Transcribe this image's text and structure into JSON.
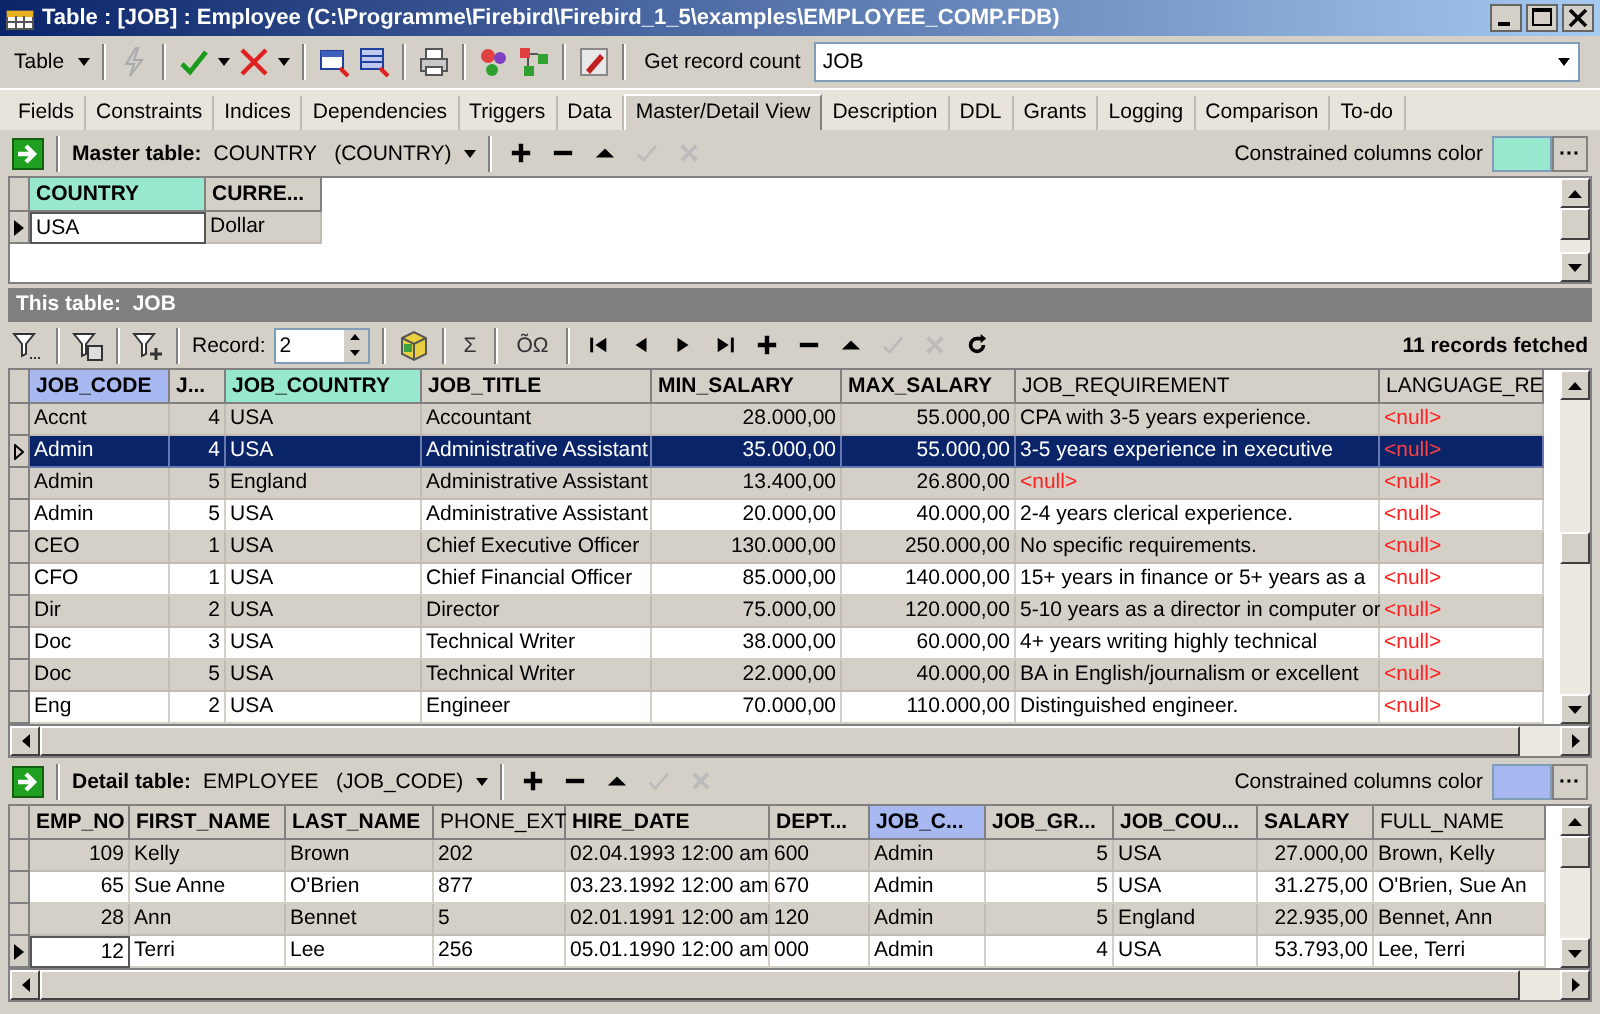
{
  "window": {
    "title": "Table : [JOB] : Employee (C:\\Programme\\Firebird\\Firebird_1_5\\examples\\EMPLOYEE_COMP.FDB)"
  },
  "toolbar": {
    "table_menu": "Table",
    "get_record_count": "Get record count",
    "table_combo": "JOB"
  },
  "tabs": [
    {
      "label": "Fields",
      "selected": false
    },
    {
      "label": "Constraints",
      "selected": false
    },
    {
      "label": "Indices",
      "selected": false
    },
    {
      "label": "Dependencies",
      "selected": false
    },
    {
      "label": "Triggers",
      "selected": false
    },
    {
      "label": "Data",
      "selected": false
    },
    {
      "label": "Master/Detail View",
      "selected": true
    },
    {
      "label": "Description",
      "selected": false
    },
    {
      "label": "DDL",
      "selected": false
    },
    {
      "label": "Grants",
      "selected": false
    },
    {
      "label": "Logging",
      "selected": false
    },
    {
      "label": "Comparison",
      "selected": false
    },
    {
      "label": "To-do",
      "selected": false
    }
  ],
  "master": {
    "label": "Master table:",
    "table": "COUNTRY   (COUNTRY)",
    "color_label": "Constrained columns color",
    "color": "#98e8d0",
    "picker": "···",
    "grid": {
      "columns": [
        {
          "name": "COUNTRY",
          "bold": true,
          "color": "#98e8d0"
        },
        {
          "name": "CURRE...",
          "bold": true
        }
      ],
      "rows": [
        {
          "cells": [
            "USA",
            "Dollar"
          ],
          "current": true
        }
      ]
    }
  },
  "this_table": "This table:  JOB",
  "job_toolbar": {
    "record_label": "Record:",
    "record": "2",
    "sigma": "Σ",
    "omega": "ÕΩ",
    "status": "11 records fetched"
  },
  "job_grid": {
    "columns": [
      {
        "name": "JOB_CODE",
        "bold": true,
        "numeric": false,
        "color": "#a8b8f0"
      },
      {
        "name": "J...",
        "bold": true,
        "numeric": true
      },
      {
        "name": "JOB_COUNTRY",
        "bold": true,
        "numeric": false,
        "color": "#98e8d0"
      },
      {
        "name": "JOB_TITLE",
        "bold": true,
        "numeric": false
      },
      {
        "name": "MIN_SALARY",
        "bold": true,
        "numeric": true
      },
      {
        "name": "MAX_SALARY",
        "bold": true,
        "numeric": true
      },
      {
        "name": "JOB_REQUIREMENT",
        "bold": false,
        "numeric": false
      },
      {
        "name": "LANGUAGE_RE",
        "bold": false,
        "numeric": false
      }
    ],
    "rows": [
      {
        "cells": [
          "Accnt",
          "4",
          "USA",
          "Accountant",
          "28.000,00",
          "55.000,00",
          "CPA with 3-5 years experience.",
          {
            "text": "<null>",
            "null": true
          }
        ],
        "selected": false
      },
      {
        "cells": [
          "Admin",
          "4",
          "USA",
          "Administrative Assistant",
          "35.000,00",
          "55.000,00",
          "3-5 years experience in executive",
          {
            "text": "<null>",
            "null": true
          }
        ],
        "selected": true
      },
      {
        "cells": [
          "Admin",
          "5",
          "England",
          "Administrative Assistant",
          "13.400,00",
          "26.800,00",
          {
            "text": "<null>",
            "null": true
          },
          {
            "text": "<null>",
            "null": true
          }
        ],
        "selected": false
      },
      {
        "cells": [
          "Admin",
          "5",
          "USA",
          "Administrative Assistant",
          "20.000,00",
          "40.000,00",
          "2-4 years clerical experience.",
          {
            "text": "<null>",
            "null": true
          }
        ],
        "selected": false
      },
      {
        "cells": [
          "CEO",
          "1",
          "USA",
          "Chief Executive Officer",
          "130.000,00",
          "250.000,00",
          "No specific requirements.",
          {
            "text": "<null>",
            "null": true
          }
        ],
        "selected": false
      },
      {
        "cells": [
          "CFO",
          "1",
          "USA",
          "Chief Financial Officer",
          "85.000,00",
          "140.000,00",
          "15+ years in finance or 5+ years as a",
          {
            "text": "<null>",
            "null": true
          }
        ],
        "selected": false
      },
      {
        "cells": [
          "Dir",
          "2",
          "USA",
          "Director",
          "75.000,00",
          "120.000,00",
          "5-10 years as a director in computer or",
          {
            "text": "<null>",
            "null": true
          }
        ],
        "selected": false
      },
      {
        "cells": [
          "Doc",
          "3",
          "USA",
          "Technical Writer",
          "38.000,00",
          "60.000,00",
          "4+ years writing highly technical",
          {
            "text": "<null>",
            "null": true
          }
        ],
        "selected": false
      },
      {
        "cells": [
          "Doc",
          "5",
          "USA",
          "Technical Writer",
          "22.000,00",
          "40.000,00",
          "BA in English/journalism or excellent",
          {
            "text": "<null>",
            "null": true
          }
        ],
        "selected": false
      },
      {
        "cells": [
          "Eng",
          "2",
          "USA",
          "Engineer",
          "70.000,00",
          "110.000,00",
          "Distinguished engineer.",
          {
            "text": "<null>",
            "null": true
          }
        ],
        "selected": false
      }
    ]
  },
  "detail": {
    "label": "Detail table:",
    "table": "EMPLOYEE   (JOB_CODE)",
    "color_label": "Constrained columns color",
    "color": "#a8b8f0",
    "picker": "···",
    "grid": {
      "columns": [
        {
          "name": "EMP_NO",
          "bold": true,
          "numeric": true
        },
        {
          "name": "FIRST_NAME",
          "bold": true,
          "numeric": false
        },
        {
          "name": "LAST_NAME",
          "bold": true,
          "numeric": false
        },
        {
          "name": "PHONE_EXT",
          "bold": false,
          "numeric": false
        },
        {
          "name": "HIRE_DATE",
          "bold": true,
          "numeric": false
        },
        {
          "name": "DEPT...",
          "bold": true,
          "numeric": false
        },
        {
          "name": "JOB_C...",
          "bold": true,
          "numeric": false,
          "color": "#a8b8f0"
        },
        {
          "name": "JOB_GR...",
          "bold": true,
          "numeric": true
        },
        {
          "name": "JOB_COU...",
          "bold": true,
          "numeric": false
        },
        {
          "name": "SALARY",
          "bold": true,
          "numeric": true
        },
        {
          "name": "FULL_NAME",
          "bold": false,
          "numeric": false
        }
      ],
      "rows": [
        {
          "cells": [
            "109",
            "Kelly",
            "Brown",
            "202",
            "02.04.1993  12:00 am",
            "600",
            "Admin",
            "5",
            "USA",
            "27.000,00",
            "Brown, Kelly"
          ],
          "current": false
        },
        {
          "cells": [
            "65",
            "Sue Anne",
            "O'Brien",
            "877",
            "03.23.1992  12:00 am",
            "670",
            "Admin",
            "5",
            "USA",
            "31.275,00",
            "O'Brien, Sue An"
          ],
          "current": false
        },
        {
          "cells": [
            "28",
            "Ann",
            "Bennet",
            "5",
            "02.01.1991  12:00 am",
            "120",
            "Admin",
            "5",
            "England",
            "22.935,00",
            "Bennet, Ann"
          ],
          "current": false
        },
        {
          "cells": [
            "12",
            "Terri",
            "Lee",
            "256",
            "05.01.1990  12:00 am",
            "000",
            "Admin",
            "4",
            "USA",
            "53.793,00",
            "Lee, Terri"
          ],
          "current": true
        }
      ]
    }
  }
}
